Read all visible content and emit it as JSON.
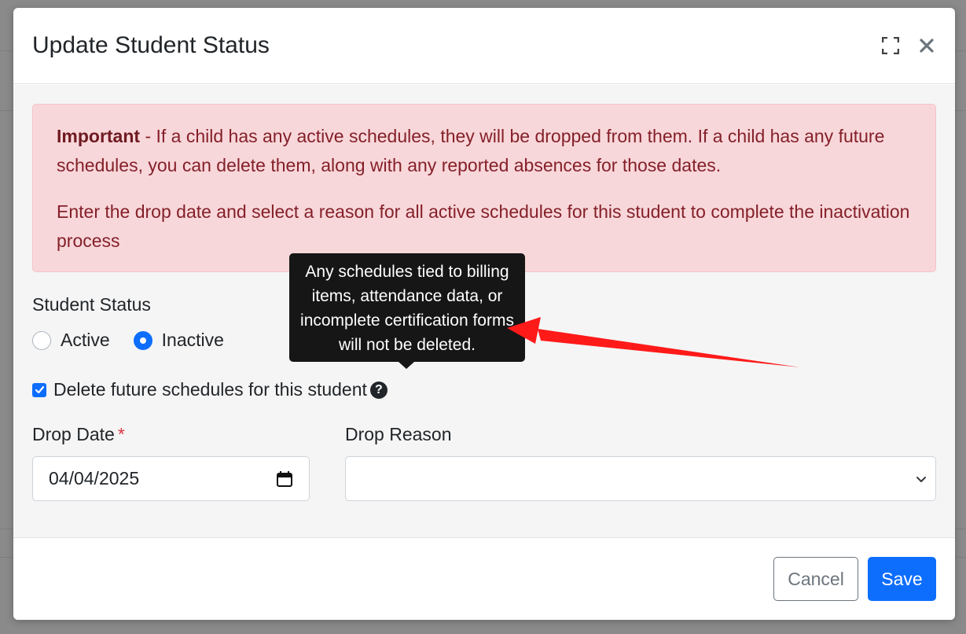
{
  "modal": {
    "title": "Update Student Status"
  },
  "alert": {
    "important_label": "Important",
    "paragraph1": " - If a child has any active schedules, they will be dropped from them. If a child has any future schedules, you can delete them, along with any reported absences for those dates.",
    "paragraph2": "Enter the drop date and select a reason for all active schedules for this student to complete the inactivation process"
  },
  "status": {
    "label": "Student Status",
    "options": [
      "Active",
      "Inactive"
    ],
    "selected": "Inactive"
  },
  "delete_future": {
    "label": "Delete future schedules for this student",
    "checked": true
  },
  "tooltip": {
    "text": "Any schedules tied to billing items, attendance data, or incomplete certification forms will not be deleted."
  },
  "drop_date": {
    "label": "Drop Date",
    "required_mark": "*",
    "value": "04/04/2025"
  },
  "drop_reason": {
    "label": "Drop Reason",
    "value": ""
  },
  "footer": {
    "cancel_label": "Cancel",
    "save_label": "Save"
  },
  "colors": {
    "primary": "#0d6efd",
    "alert_bg": "#f8d7da",
    "alert_text": "#842029",
    "annotation_arrow": "#ff1a1a"
  },
  "icons": {
    "expand": "expand-icon",
    "close": "close-icon",
    "help": "question-circle-icon",
    "calendar": "calendar-icon",
    "chevron": "chevron-down-icon"
  }
}
